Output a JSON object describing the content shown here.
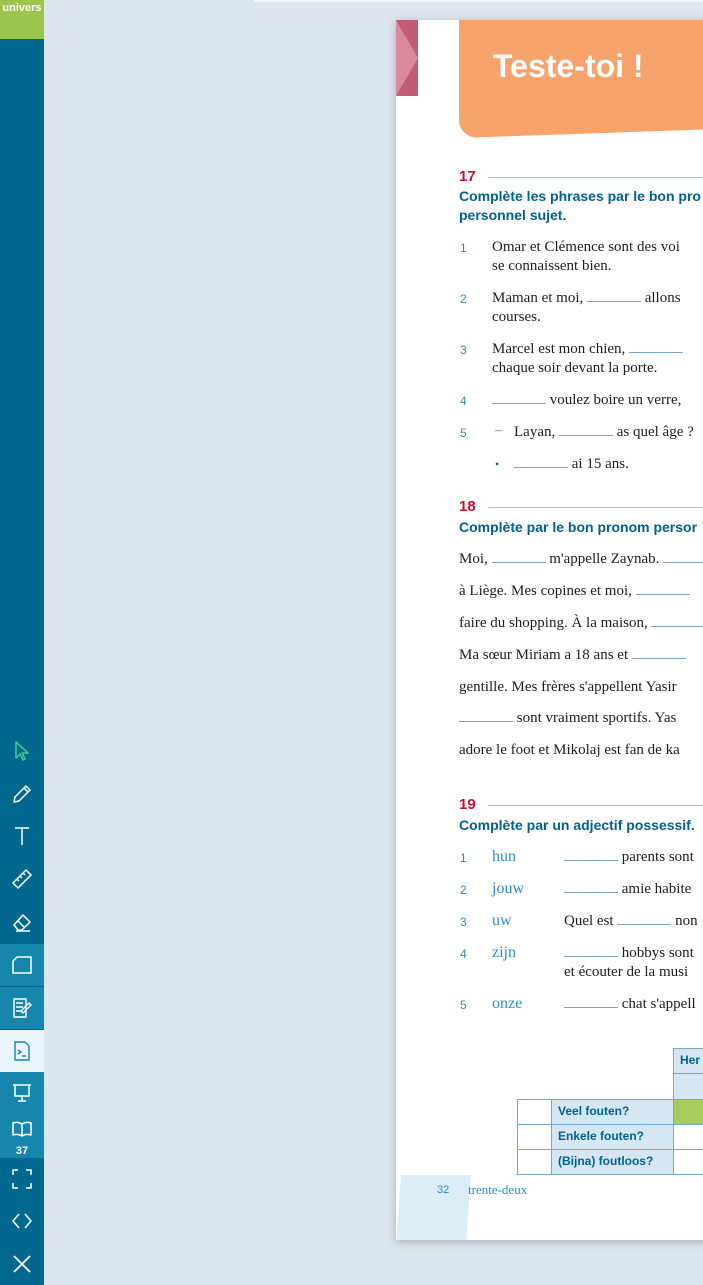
{
  "sidebar": {
    "logo": "univers",
    "page_badge": "37"
  },
  "icons": [
    "pointer-icon",
    "pencil-icon",
    "text-icon",
    "ruler-icon",
    "eraser-icon",
    "frame-icon",
    "notes-icon",
    "worksheet-icon",
    "presentation-icon",
    "book-icon",
    "fullscreen-icon",
    "navigate-icon",
    "close-icon"
  ],
  "colors": {
    "sidebar": "#00688f",
    "accent_green": "#9cc54f",
    "banner": "#f7a36b",
    "exercise_number": "#c8102e",
    "heading": "#00628f"
  },
  "page": {
    "title": "Teste-toi !",
    "ex17": {
      "number": "17",
      "heading_1": "Complète les phrases par le bon pro",
      "heading_2": "personnel sujet.",
      "items": [
        {
          "n": "1",
          "a": "Omar et Clémence sont des voi",
          "b": "se connaissent bien."
        },
        {
          "n": "2",
          "a": "Maman et moi,",
          "a2": "allons",
          "b": "courses."
        },
        {
          "n": "3",
          "a": "Marcel est mon chien,",
          "b": "chaque soir devant la porte."
        },
        {
          "n": "4",
          "a": "voulez boire un verre,"
        },
        {
          "n": "5",
          "dash": "–",
          "a": "Layan,",
          "a2": "as quel âge ?"
        },
        {
          "bullet": "•",
          "a": "ai 15 ans."
        }
      ]
    },
    "ex18": {
      "number": "18",
      "heading": "Complète par le bon pronom persor",
      "lines": [
        {
          "pre": "Moi,",
          "post": "m'appelle Zaynab."
        },
        {
          "pre": "à Liège. Mes copines et moi,"
        },
        {
          "pre": "faire du shopping. À la maison,"
        },
        {
          "pre": "Ma sœur Miriam a 18 ans et"
        },
        {
          "pre": "gentille. Mes frères s'appellent Yasir"
        },
        {
          "post": "sont vraiment sportifs. Yas"
        },
        {
          "pre": "adore le foot et Mikolaj est fan de ka"
        }
      ]
    },
    "ex19": {
      "number": "19",
      "heading": "Complète par un adjectif possessif.",
      "items": [
        {
          "n": "1",
          "nl": "hun",
          "post": "parents sont"
        },
        {
          "n": "2",
          "nl": "jouw",
          "post": "amie habite"
        },
        {
          "n": "3",
          "nl": "uw",
          "pre": "Quel est",
          "post": "non"
        },
        {
          "n": "4",
          "nl": "zijn",
          "post": "hobbys sont",
          "line2": "et écouter de la musi"
        },
        {
          "n": "5",
          "nl": "onze",
          "post": "chat s'appell"
        }
      ]
    },
    "table": {
      "header": "Her",
      "rows": [
        "Veel fouten?",
        "Enkele fouten?",
        "(Bijna) foutloos?"
      ]
    },
    "footer": {
      "page_number": "32",
      "page_word": "trente-deux"
    }
  }
}
